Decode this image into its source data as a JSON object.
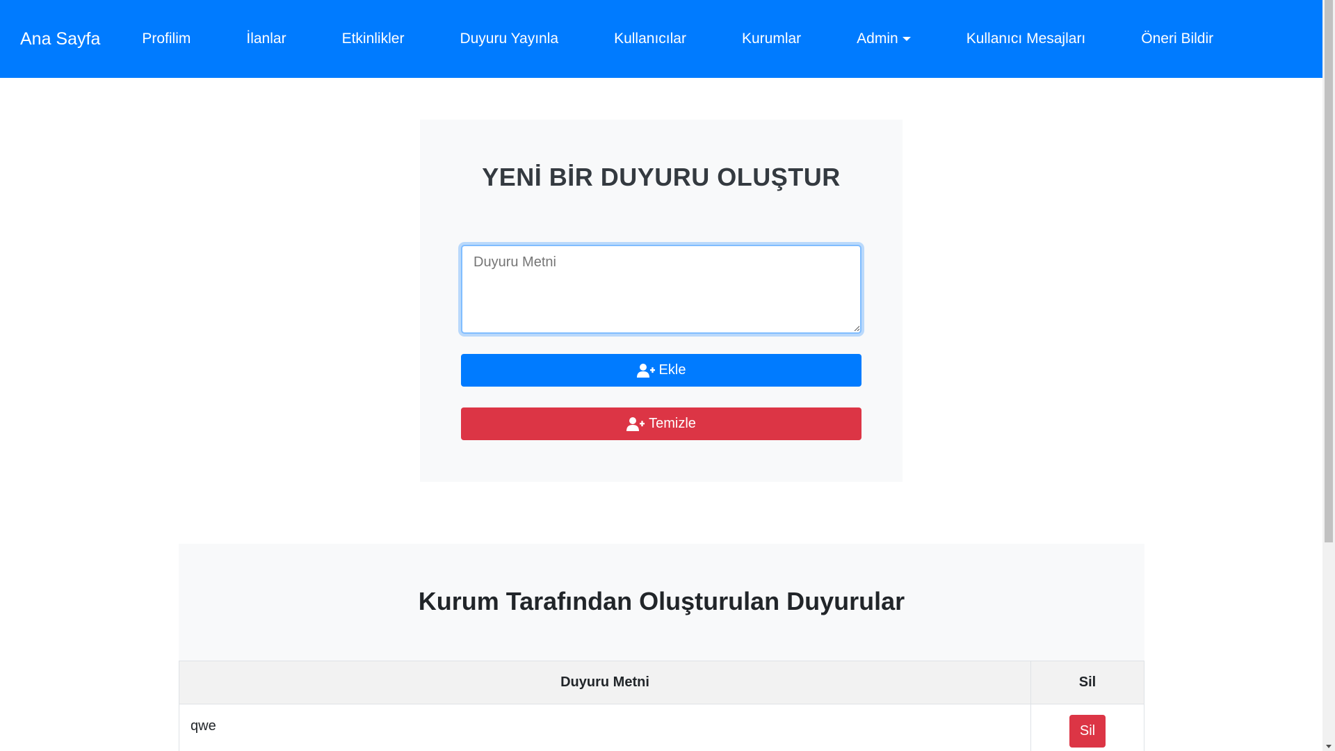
{
  "nav": {
    "brand": "Ana Sayfa",
    "items": [
      {
        "label": "Profilim"
      },
      {
        "label": "İlanlar"
      },
      {
        "label": "Etkinlikler"
      },
      {
        "label": "Duyuru Yayınla"
      },
      {
        "label": "Kullanıcılar"
      },
      {
        "label": "Kurumlar"
      },
      {
        "label": "Admin",
        "dropdown": true
      },
      {
        "label": "Kullanıcı Mesajları"
      },
      {
        "label": "Öneri Bildir"
      }
    ]
  },
  "form": {
    "title": "YENİ BİR DUYURU OLUŞTUR",
    "textarea_placeholder": "Duyuru Metni",
    "textarea_value": "",
    "add_label": "Ekle",
    "clear_label": "Temizle",
    "add_icon": "user-plus-icon",
    "clear_icon": "user-plus-icon"
  },
  "list": {
    "title": "Kurum Tarafından Oluşturulan Duyurular",
    "columns": [
      "Duyuru Metni",
      "Sil"
    ],
    "rows": [
      {
        "text": "qwe",
        "delete_label": "Sil"
      }
    ]
  },
  "colors": {
    "primary": "#007bff",
    "danger": "#dc3545",
    "card_bg": "#f8f9fa"
  }
}
